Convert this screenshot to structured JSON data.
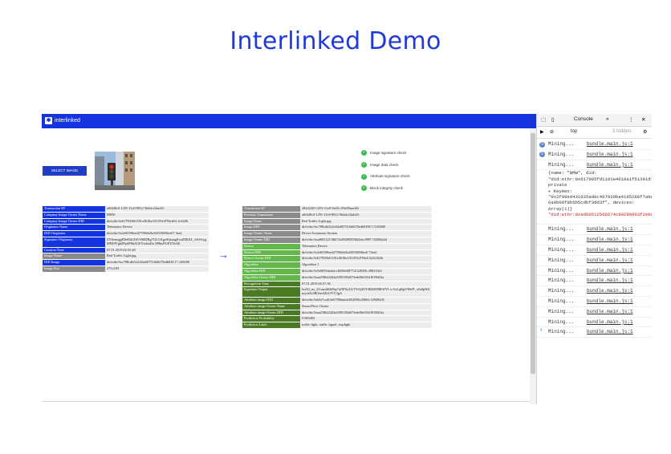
{
  "page": {
    "title": "Interlinked Demo"
  },
  "app": {
    "brand": "interlinked",
    "select_button": "SELECT IMAGE",
    "checks": [
      "Image signature check",
      "Image data check",
      "Attribute signature check",
      "Block integrity check"
    ],
    "arrow": "→",
    "left_table": [
      {
        "k": "Transaction ID",
        "v": "a0f4d8c0-1291-11e9-8812-5b6dc24afc65"
      },
      {
        "k": "Company Image Owner Name",
        "v": "BMW"
      },
      {
        "k": "Company Image Owner DID",
        "v": "did:ethr:0x617905fd1181e4618a1f51391d794cb62 4c022b"
      },
      {
        "k": "Originator Name",
        "v": "Telematics Device"
      },
      {
        "k": "DID Originator",
        "v": "did:ethr:0x2e6f598ae42759b0a9a3435f0f8ffee67 3ea2"
      },
      {
        "k": "Signature Originator",
        "v": "ZYbvmqgjB0eD4cZhVO6RJRg7GLOAgo9fjeuug8 mZDkXL_hAOvygM9Z9Vgb8PpSP8hAUEYsrfmDa 398bsPUEY5SAE"
      },
      {
        "k": "Creation Time",
        "v": "07.01.2019 04:55:48"
      },
      {
        "k": "Image Name",
        "v": "Red Traffic Light.jpg"
      },
      {
        "k": "DID Image",
        "v": "did:ethr:0xc788cdb522c62a607516fdb70edb818 17 220680"
      },
      {
        "k": "Image Size",
        "v": "275x183"
      }
    ],
    "right_table": [
      {
        "k": "Transaction ID",
        "v": "284422f0-1292-11e9-9a50-c95e09aeaf63"
      },
      {
        "k": "Previous Transaction",
        "v": "a0f4d8c0-1291-11e9-8812-5b6dc24afc65"
      },
      {
        "k": "Image Name",
        "v": "Red Traffic Light.jpg"
      },
      {
        "k": "Image DID",
        "v": "did:ethr:0xc788cdb522c62a607516fdb70edb8188 17220680"
      },
      {
        "k": "Image Owner Name",
        "v": "Driver Assistance System"
      },
      {
        "k": "Image Owner DID",
        "v": "did:ethr:0xad605125 66674c802909036f2ebcf909 74f26bb2d"
      },
      {
        "k": "Device",
        "v": "Telematics Device"
      },
      {
        "k": "Device DID",
        "v": "did:ethr:0x2e6f598ae42759b0a9a3435f0f8ffee6 73ea2"
      },
      {
        "k": "Device Owner DID",
        "v": "did:ethr:0x617905fd1181e4618a1f51391d794cb 624c022b"
      },
      {
        "k": "Algorithm",
        "v": "Algorithm 1"
      },
      {
        "k": "Algorithm DID",
        "v": "did:ethr:0x5e68354ada1c46566df8774132830b 288210e3"
      },
      {
        "k": "Algorithm Owner DID",
        "v": "did:ethr:0xaa258b2f2d2a5f901384673ede9b035d 8f58432a"
      },
      {
        "k": "Recognition Time",
        "v": "07.01.2019 04:57:36"
      },
      {
        "k": "Signature Output",
        "v": "lxsNJ_nx_23-ansbKh09p7aOFXuULTYtQ4OT4842698KWVI w-5xLqRgV98eP-_e6dfp961myvb5r3ROnoAKrOVY3gA"
      },
      {
        "k": "Attribute image DID",
        "v": "did:ethr:0xb5a7ca4f3e67598ade4df52096c25664 429d92d5"
      },
      {
        "k": "Attribute image Owner Name",
        "v": "SensorFlow Owner"
      },
      {
        "k": "Attribute image Owner DID",
        "v": "did:ethr:0xaa258b2f2d2a5f901384673ede9b035d 8f58432a"
      },
      {
        "k": "Prediction Probability",
        "v": "0.983483"
      },
      {
        "k": "Prediction Label",
        "v": "traffic light, traffic signal, stoplight"
      }
    ],
    "right_colors": [
      "gray",
      "gray",
      "gray",
      "gray",
      "gray",
      "gray",
      "lg",
      "lg",
      "lg",
      "lg",
      "lg",
      "lg",
      "dg",
      "dg",
      "dg",
      "dg",
      "dg",
      "dg",
      "dg"
    ]
  },
  "devtools": {
    "tab_label": "Console",
    "more": "»",
    "context": "top",
    "hidden": "3 hidden",
    "log_source": "bundle.main.js:1",
    "log_message": "Mining...",
    "object_lines": [
      "{name: \"BMW\", did: \"did:ethr:0x617905fd1181e4618a1f51391d794cb624c022b\", private",
      "▸ KeyHex: \"0x2f09ed431035adec467930ba4195288f7abd60595c5 6a9b00f8b5b5cdbf3dd3f\", devices: Array(1)}",
      "\"did:ethr:0xad60512566674c80290903f2ebcf90974f26bb2d\""
    ],
    "prompt": "›"
  }
}
